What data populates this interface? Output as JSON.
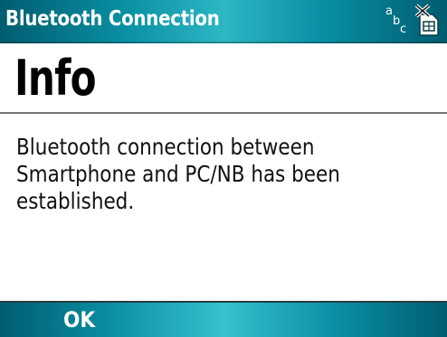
{
  "titlebar": {
    "title": "Bluetooth Connection",
    "input_mode": {
      "a": "a",
      "b": "b",
      "c": "c"
    },
    "status_icon": "no-sim-icon"
  },
  "dialog": {
    "heading": "Info",
    "message": "Bluetooth connection between Smartphone and PC/NB has been established."
  },
  "softkeys": {
    "left_label": "OK"
  },
  "colors": {
    "bar_dark": "#005d70",
    "bar_light": "#35c1cd",
    "divider": "#6f7479"
  }
}
